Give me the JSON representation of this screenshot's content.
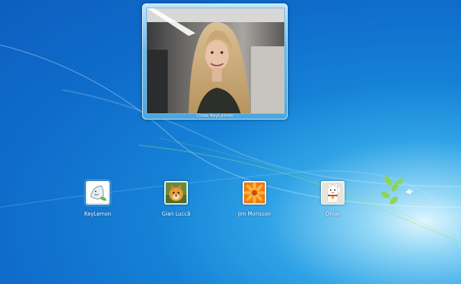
{
  "webcam": {
    "caption": "Close KeyLemon"
  },
  "users": [
    {
      "name": "KeyLemon",
      "icon": "keylemon-logo-icon"
    },
    {
      "name": "Gian Luccã",
      "icon": "dog-icon"
    },
    {
      "name": "Jim Morisson",
      "icon": "flower-icon"
    },
    {
      "name": "Omar",
      "icon": "lucky-cat-icon"
    }
  ],
  "colors": {
    "background": "#1581d6",
    "frame": "#6cbbe8",
    "text": "#ffffff"
  }
}
